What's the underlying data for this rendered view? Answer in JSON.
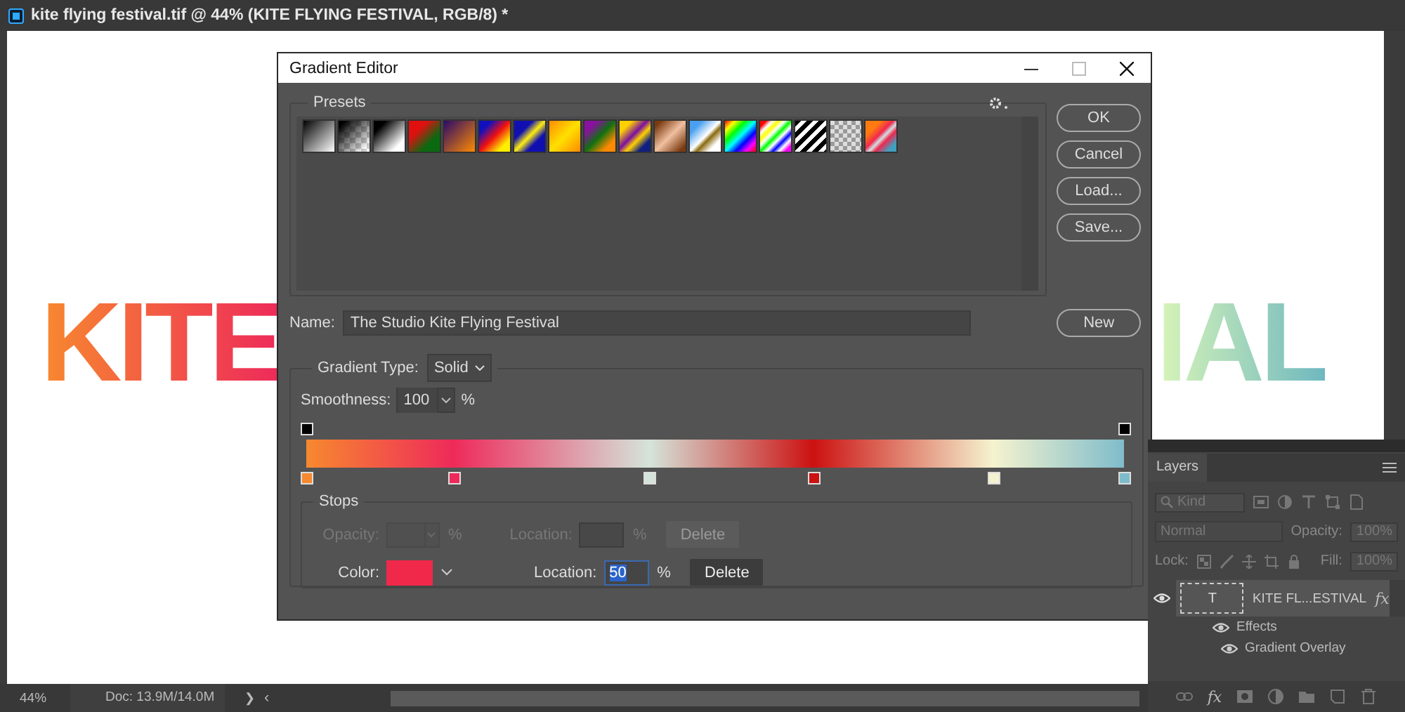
{
  "window": {
    "title": "kite flying festival.tif @ 44% (KITE FLYING FESTIVAL, RGB/8) *"
  },
  "canvas": {
    "texts": [
      {
        "text": "KITE"
      },
      {
        "text": "IAL"
      }
    ]
  },
  "dialog": {
    "title": "Gradient Editor",
    "presets": {
      "label": "Presets"
    },
    "buttons": [
      "OK",
      "Cancel",
      "Load...",
      "Save..."
    ],
    "name": {
      "label": "Name:",
      "value": "The Studio Kite Flying Festival"
    },
    "new_button": "New",
    "gradient_type": {
      "label": "Gradient Type:",
      "value": "Solid"
    },
    "smoothness": {
      "label": "Smoothness:",
      "value": "100",
      "unit": "%"
    },
    "opacity_stops": [
      {
        "level": 0
      },
      {
        "level": 1
      }
    ],
    "color_stops": [
      {
        "level": 0,
        "color": "#f7892f"
      },
      {
        "level": 0.18,
        "color": "#ee2a5a"
      },
      {
        "level": 0.42,
        "color": "#d5e4da"
      },
      {
        "level": 0.62,
        "color": "#cc1111"
      },
      {
        "level": 0.84,
        "color": "#f5f3cf"
      },
      {
        "level": 1,
        "color": "#7fbccb"
      }
    ],
    "stops": {
      "label": "Stops",
      "rows": [
        {
          "kind": "opacity",
          "disabled": true,
          "label": "Opacity:",
          "unit": "%",
          "location_label": "Location:",
          "location_unit": "%",
          "button": "Delete"
        },
        {
          "kind": "color",
          "disabled": false,
          "label": "Color:",
          "color": "#f0284a",
          "location_label": "Location:",
          "location_value": "50",
          "location_unit": "%",
          "button": "Delete"
        }
      ]
    }
  },
  "layers": {
    "tab": "Layers",
    "filter_placeholder": "Kind",
    "blend_mode": "Normal",
    "opacity_label": "Opacity:",
    "opacity_value": "100%",
    "lock_label": "Lock:",
    "fill_label": "Fill:",
    "fill_value": "100%",
    "layer": {
      "thumbnail": "T",
      "name": "KITE FL...ESTIVAL",
      "visible": true,
      "fx": "fx",
      "effects_label": "Effects",
      "effects_visible": true,
      "effects": [
        {
          "name": "Gradient Overlay",
          "visible": true
        }
      ]
    },
    "bottom_fx": "fx"
  },
  "status_bar": {
    "zoom": "44%",
    "doc": "Doc: 13.9M/14.0M",
    "next": "❯",
    "prev": "‹"
  }
}
